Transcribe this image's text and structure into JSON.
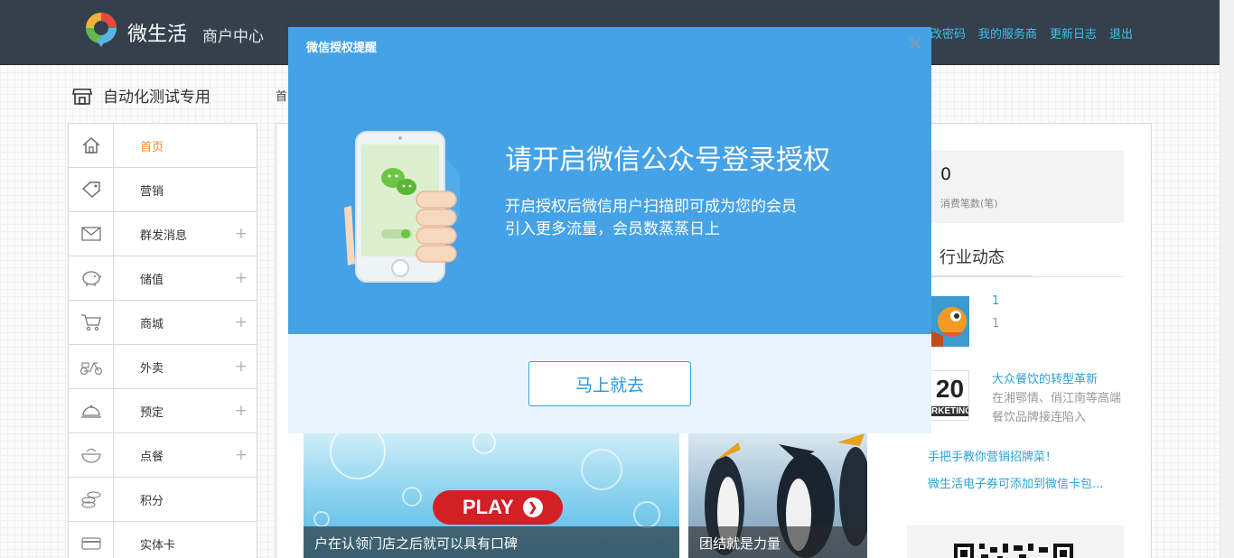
{
  "header": {
    "brand": "微生活",
    "subtitle": "商户中心",
    "links": [
      "改密码",
      "我的服务商",
      "更新日志",
      "退出"
    ],
    "background": "#34414d",
    "link_color": "#3cc0f0"
  },
  "store": {
    "title": "自动化测试专用",
    "breadcrumb": "首"
  },
  "sidebar": {
    "items": [
      {
        "label": "首页",
        "icon": "home-icon",
        "expandable": false,
        "active": true
      },
      {
        "label": "营销",
        "icon": "tag-icon",
        "expandable": false
      },
      {
        "label": "群发消息",
        "icon": "envelope-icon",
        "expandable": true
      },
      {
        "label": "储值",
        "icon": "piggy-bank-icon",
        "expandable": true
      },
      {
        "label": "商城",
        "icon": "cart-icon",
        "expandable": true
      },
      {
        "label": "外卖",
        "icon": "scooter-icon",
        "expandable": true
      },
      {
        "label": "预定",
        "icon": "cloche-icon",
        "expandable": true
      },
      {
        "label": "点餐",
        "icon": "bowl-icon",
        "expandable": true
      },
      {
        "label": "积分",
        "icon": "coins-icon",
        "expandable": false
      },
      {
        "label": "实体卡",
        "icon": "card-icon",
        "expandable": false
      }
    ],
    "plus_symbol": "+",
    "active_color": "#f08c2c"
  },
  "stats": {
    "value": "0",
    "label": "消费笔数(笔)"
  },
  "news": {
    "heading": "行业动态",
    "items": [
      {
        "title": "1",
        "subtitle": "1",
        "thumb": "cartoon-thumbnail"
      },
      {
        "title": "大众餐饮的转型革新",
        "subtitle": "在湘鄂情、俏江南等高端餐饮品牌接连陷入",
        "thumb": "o2o-marketing-thumbnail",
        "thumb_text_top": "20",
        "thumb_text_bottom": "RKETING"
      }
    ],
    "links": [
      "手把手教你营销招牌菜！",
      "微生活电子券可添加到微信卡包..."
    ]
  },
  "banners": [
    {
      "caption": "户在认领门店之后就可以具有口碑",
      "play_label": "PLAY"
    },
    {
      "caption": "团结就是力量"
    }
  ],
  "modal": {
    "caption": "微信授权提醒",
    "close": "×",
    "headline": "请开启微信公众号登录授权",
    "desc_line1": "开启授权后微信用户扫描即可成为您的会员",
    "desc_line2": "引入更多流量，会员数蒸蒸日上",
    "button": "马上就去",
    "top_color": "#46a2e6",
    "bottom_color": "#e9f5fc"
  }
}
